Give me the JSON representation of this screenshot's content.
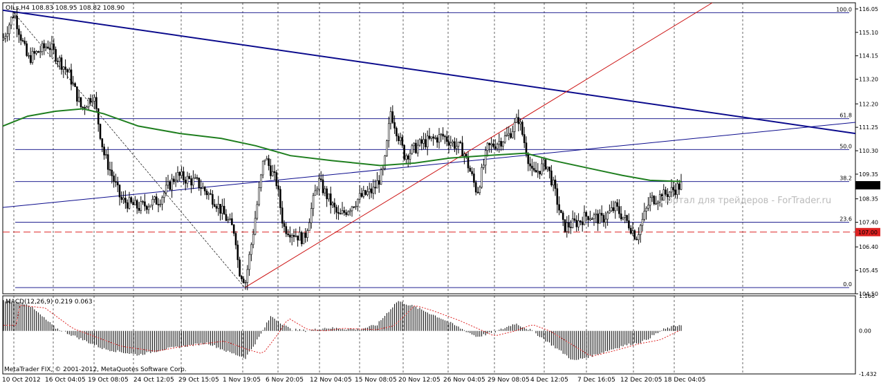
{
  "chart_data": [
    {
      "type": "candlestick",
      "symbol_line": "OILs,H4  108.83 108.95 108.82 108.90",
      "ylim": [
        104.5,
        116.3
      ],
      "price_ticks": [
        "116.05",
        "115.10",
        "114.15",
        "113.20",
        "112.20",
        "111.25",
        "110.30",
        "109.35",
        "108.35",
        "107.40",
        "106.40",
        "105.45",
        "104.50"
      ],
      "x_labels": [
        "10 Oct 2012",
        "16 Oct 04:05",
        "19 Oct 08:05",
        "24 Oct 12:05",
        "29 Oct 15:05",
        "1 Nov 19:05",
        "6 Nov 20:05",
        "12 Nov 04:05",
        "15 Nov 08:05",
        "20 Nov 12:05",
        "26 Nov 04:05",
        "29 Nov 08:05",
        "4 Dec 12:05",
        "7 Dec 16:05",
        "12 Dec 20:05",
        "18 Dec 04:05"
      ],
      "current_price": "108.90",
      "horizontal_level": {
        "value": 107.0,
        "label": "107.00",
        "color": "#dd2222"
      },
      "fibonacci": {
        "color": "#000080",
        "levels": [
          {
            "label": "100.0",
            "value": 115.9
          },
          {
            "label": "61.8",
            "value": 111.6
          },
          {
            "label": "50.0",
            "value": 110.35
          },
          {
            "label": "38.2",
            "value": 109.05
          },
          {
            "label": "23.6",
            "value": 107.4
          },
          {
            "label": "0.0",
            "value": 104.75
          }
        ]
      },
      "moving_average_color": "#1e7e1e",
      "watermark": "Портал для трейдеров - ForTrader.ru"
    },
    {
      "type": "histogram",
      "indicator_label": "MACD(12,26,9) 0.219 0.063",
      "ylim": [
        -1.432,
        1.166
      ],
      "ticks": [
        "1.166",
        "0.00",
        "-1.432"
      ],
      "signal_color": "#dd2222"
    }
  ],
  "footer": {
    "copyright": "MetaTrader FIX, © 2001-2012, MetaQuotes Software Corp."
  }
}
